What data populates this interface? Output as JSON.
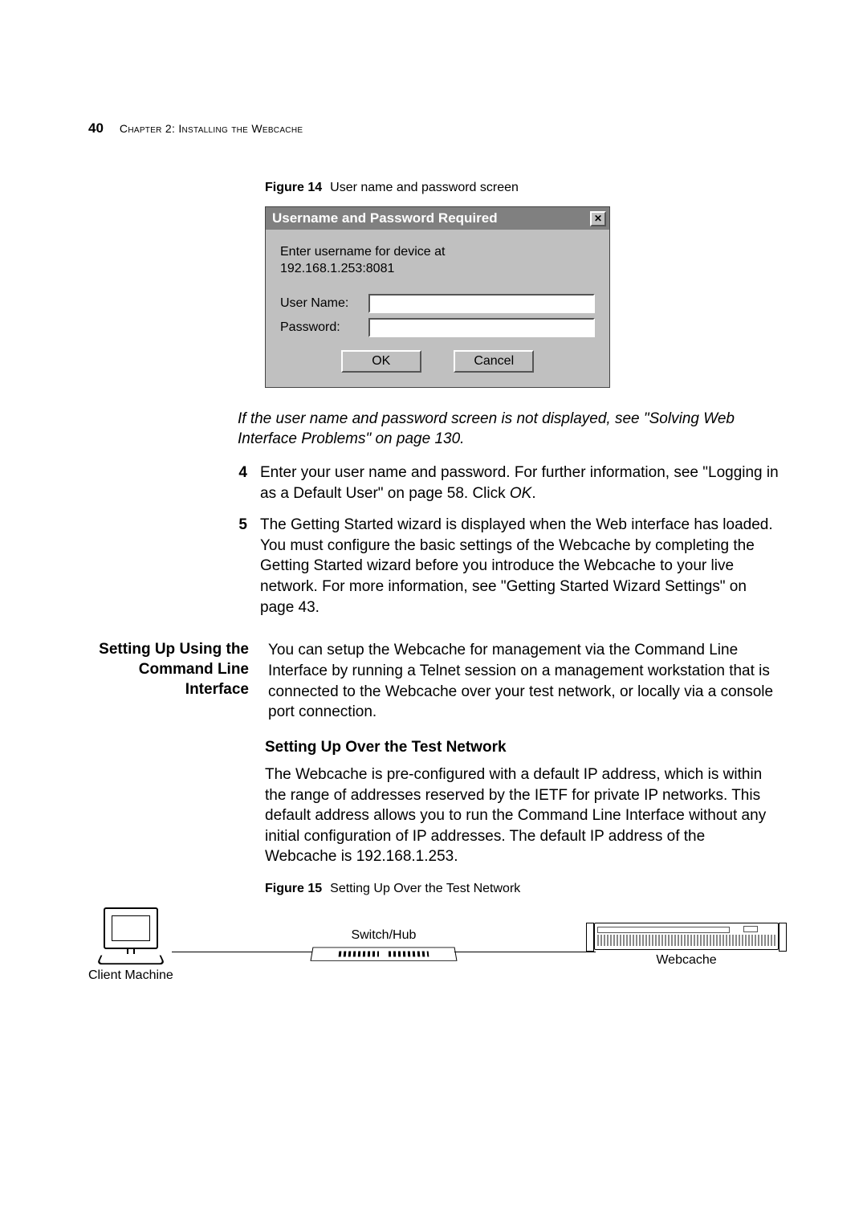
{
  "header": {
    "page_number": "40",
    "chapter": "Chapter 2: Installing the Webcache"
  },
  "fig14": {
    "label": "Figure 14",
    "caption": "User name and password screen"
  },
  "dialog": {
    "title": "Username and Password Required",
    "close_glyph": "✕",
    "message_line1": "Enter username for device at",
    "message_line2": "192.168.1.253:8081",
    "username_label": "User Name:",
    "password_label": "Password:",
    "ok": "OK",
    "cancel": "Cancel"
  },
  "info_note": "If the user name and password screen is not displayed, see \"Solving Web Interface Problems\" on page 130.",
  "steps": {
    "item4_num": "4",
    "item4_text_a": "Enter your user name and password. For further information, see \"Logging in as a Default User\" on page 58. Click ",
    "item4_text_ok": "OK",
    "item4_text_b": ".",
    "item5_num": "5",
    "item5_text": "The Getting Started wizard is displayed when the Web interface has loaded. You must configure the basic settings of the Webcache by completing the Getting Started wizard before you introduce the Webcache to your live network. For more information, see \"Getting Started Wizard Settings\" on page 43."
  },
  "section": {
    "side_heading": "Setting Up Using the Command Line Interface",
    "body": "You can setup the Webcache for management via the Command Line Interface by running a Telnet session on a management workstation that is connected to the Webcache over your test network, or locally via a console port connection."
  },
  "subheading": "Setting Up Over the Test Network",
  "para": "The Webcache is pre-configured with a default IP address, which is within the range of addresses reserved by the IETF for private IP networks. This default address allows you to run the Command Line Interface without any initial configuration of IP addresses. The default IP address of the Webcache is 192.168.1.253.",
  "fig15": {
    "label": "Figure 15",
    "caption": "Setting Up Over the Test Network"
  },
  "netfig": {
    "client": "Client Machine",
    "switch": "Switch/Hub",
    "webcache": "Webcache"
  }
}
